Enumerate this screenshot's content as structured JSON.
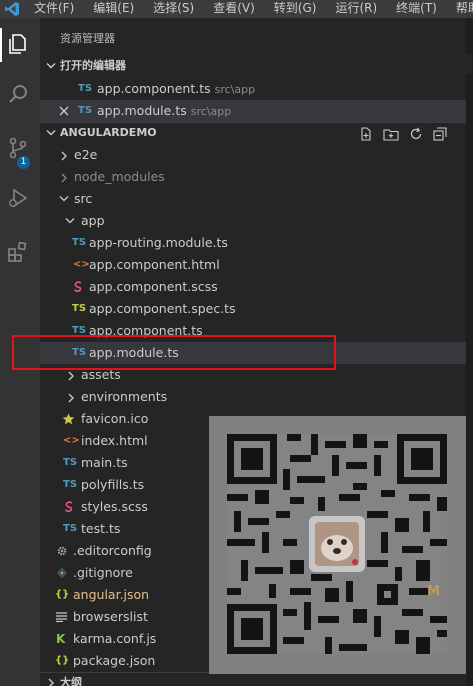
{
  "menu": [
    "文件(F)",
    "编辑(E)",
    "选择(S)",
    "查看(V)",
    "转到(G)",
    "运行(R)",
    "终端(T)",
    "帮助(H)"
  ],
  "activity": {
    "scm_badge": "1"
  },
  "explorer": {
    "title": "资源管理器",
    "open_editors": {
      "header": "打开的编辑器",
      "items": [
        {
          "icon": "TS",
          "name": "app.component.ts",
          "path": "src\\app"
        },
        {
          "icon": "TS",
          "name": "app.module.ts",
          "path": "src\\app"
        }
      ]
    },
    "project": {
      "header": "ANGULARDEMO",
      "tree": [
        {
          "name": "e2e"
        },
        {
          "name": "node_modules"
        },
        {
          "name": "src"
        },
        {
          "name": "app"
        },
        {
          "icon": "TS",
          "name": "app-routing.module.ts"
        },
        {
          "icon": "<>",
          "name": "app.component.html"
        },
        {
          "icon": "scss",
          "name": "app.component.scss"
        },
        {
          "icon": "TS",
          "name": "app.component.spec.ts"
        },
        {
          "icon": "TS",
          "name": "app.component.ts"
        },
        {
          "icon": "TS",
          "name": "app.module.ts"
        },
        {
          "name": "assets"
        },
        {
          "name": "environments"
        },
        {
          "icon": "star",
          "name": "favicon.ico"
        },
        {
          "icon": "<>",
          "name": "index.html"
        },
        {
          "icon": "TS",
          "name": "main.ts"
        },
        {
          "icon": "TS",
          "name": "polyfills.ts"
        },
        {
          "icon": "scss",
          "name": "styles.scss"
        },
        {
          "icon": "TS",
          "name": "test.ts"
        },
        {
          "icon": "gear",
          "name": ".editorconfig"
        },
        {
          "icon": "git",
          "name": ".gitignore"
        },
        {
          "icon": "{}",
          "name": "angular.json"
        },
        {
          "icon": "lines",
          "name": "browserslist"
        },
        {
          "icon": "K",
          "name": "karma.conf.js"
        },
        {
          "icon": "{}",
          "name": "package.json"
        }
      ]
    },
    "outline_header": "大纲"
  },
  "watermark_letter": "M",
  "colors": {
    "ts": "#519aba",
    "html": "#e37933",
    "scss": "#f55385",
    "json": "#cbcb41",
    "spec": "#cbcb41",
    "highlight": "#e0151a"
  }
}
